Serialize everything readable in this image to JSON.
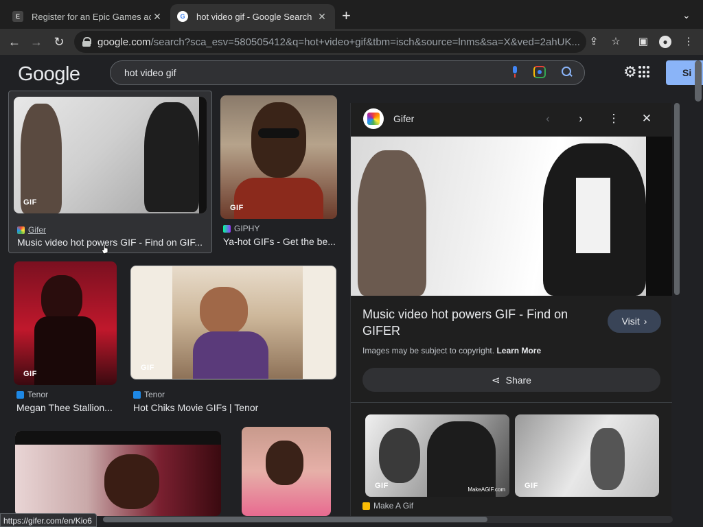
{
  "browser": {
    "tabs": [
      {
        "title": "Register for an Epic Games acc",
        "favicon": "epic-games-icon"
      },
      {
        "title": "hot video gif - Google Search",
        "favicon": "google-icon"
      }
    ],
    "url_domain": "google.com",
    "url_path": "/search?sca_esv=580505412&q=hot+video+gif&tbm=isch&source=lnms&sa=X&ved=2ahUK..."
  },
  "google": {
    "logo": "Google",
    "query": "hot video gif",
    "signin_label": "Si"
  },
  "results": [
    {
      "source": "Gifer",
      "caption": "Music video hot powers GIF - Find on GIF...",
      "badge": "GIF"
    },
    {
      "source": "GIPHY",
      "caption": "Ya-hot GIFs - Get the be...",
      "badge": "GIF"
    },
    {
      "source": "Tenor",
      "caption": "Megan Thee Stallion...",
      "badge": "GIF"
    },
    {
      "source": "Tenor",
      "caption": "Hot Chiks Movie GIFs | Tenor",
      "badge": "GIF"
    }
  ],
  "panel": {
    "source": "Gifer",
    "title": "Music video hot powers GIF - Find on GIFER",
    "visit_label": "Visit",
    "copyright": "Images may be subject to copyright.",
    "learn_more": "Learn More",
    "share_label": "Share",
    "related": [
      {
        "badge": "GIF",
        "watermark": "MakeAGIF.com"
      },
      {
        "badge": "GIF"
      }
    ],
    "related_source": "Make A Gif"
  },
  "status_url": "https://gifer.com/en/Kio6",
  "colors": {
    "accent": "#8ab4f8",
    "background": "#202124",
    "visit_bg": "#394457"
  }
}
